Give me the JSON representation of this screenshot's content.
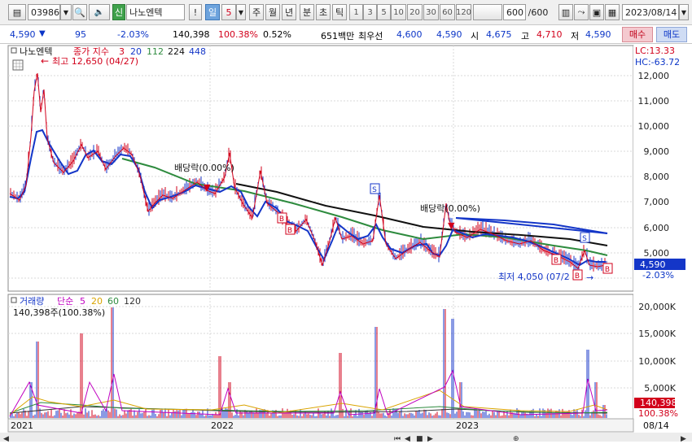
{
  "toolbar": {
    "code": "039860",
    "badge": "신",
    "name": "나노엔텍",
    "excl": "!",
    "periods": [
      "일",
      "5",
      "주",
      "월",
      "년",
      "분",
      "초",
      "틱"
    ],
    "minutes": [
      "1",
      "3",
      "5",
      "10",
      "20",
      "30",
      "60",
      "120"
    ],
    "count": "600",
    "count_total": "/600",
    "date": "2023/08/14"
  },
  "price_bar": {
    "price": "4,590",
    "change": "95",
    "change_pct": "-2.03%",
    "volume": "140,398",
    "vol_ratio": "100.38%",
    "turnover": "0.52%",
    "amount": "651백만",
    "best_label": "최우선",
    "ask": "4,600",
    "bid": "4,590",
    "open_label": "시",
    "open": "4,675",
    "high_label": "고",
    "high": "4,710",
    "low_label": "저",
    "low": "4,590",
    "buy_btn": "매수",
    "sell_btn": "매도"
  },
  "price_chart": {
    "legend_name": "나노엔텍",
    "legend_type": "종가 지수",
    "ma": [
      "3",
      "20",
      "112",
      "224",
      "448"
    ],
    "ma_colors": [
      "#d2001b",
      "#1436c8",
      "#2e8b3e",
      "#111111",
      "#1436c8"
    ],
    "lc": "LC:13.33",
    "hc": "HC:-63.72",
    "high_note": "최고 12,650 (04/27)",
    "low_note": "최저 4,050 (07/2",
    "div_note": "배당락(0.00%)",
    "price_tag": "4,590",
    "price_tag_pct": "-2.03%",
    "buy_marker": "B",
    "sell_marker": "S"
  },
  "volume_chart": {
    "legend_name": "거래량",
    "legend_type": "단순",
    "ma": [
      "5",
      "20",
      "60",
      "120"
    ],
    "ma_colors": [
      "#c000c0",
      "#d9a400",
      "#2e8b3e",
      "#333333"
    ],
    "vol_text": "140,398주(100.38%)",
    "tag_vol": "140,398",
    "tag_pct": "100.38%"
  },
  "x_labels": [
    "2021",
    "2022",
    "2023"
  ],
  "x_right": "08/14",
  "chart_data": {
    "type": "line",
    "title": "",
    "price_ticks": [
      12000,
      11000,
      10000,
      9000,
      8000,
      7000,
      6000,
      5000
    ],
    "volume_ticks": [
      "20,000K",
      "15,000K",
      "10,000K",
      "5,000K"
    ],
    "x": [
      "2021",
      "2022",
      "2023",
      "08/14"
    ],
    "series": [
      {
        "name": "3",
        "values": [
          7200,
          12650,
          9500,
          8500,
          7100,
          7600,
          6500,
          5200,
          5600,
          5400,
          5200,
          5900,
          5700,
          5200,
          4600,
          4590
        ]
      },
      {
        "name": "20",
        "values": [
          7200,
          9800,
          8800,
          8200,
          7200,
          7400,
          6600,
          5400,
          5600,
          5400,
          5300,
          5800,
          5700,
          5300,
          4800,
          4700
        ]
      },
      {
        "name": "112",
        "values": [
          8500,
          8000,
          7500,
          7200,
          6800,
          6200,
          5800,
          5400,
          5200,
          4900
        ]
      },
      {
        "name": "224",
        "values": [
          7500,
          7200,
          6800,
          6400,
          6000,
          5800,
          5500,
          5300
        ]
      }
    ],
    "ylim": [
      4000,
      12650
    ]
  }
}
